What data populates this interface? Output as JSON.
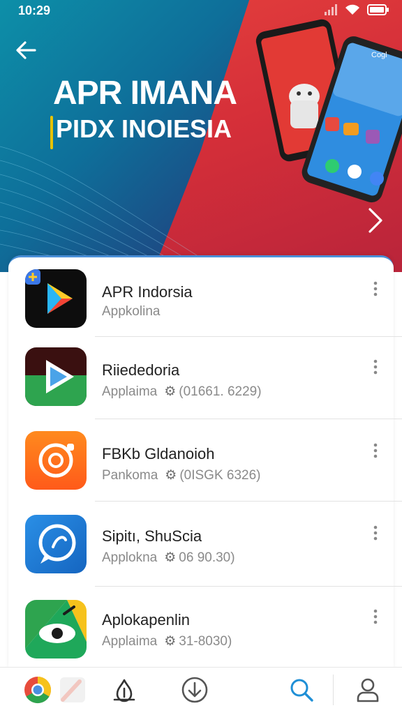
{
  "status_bar": {
    "time": "10:29"
  },
  "hero": {
    "title": "APR IMANA",
    "subtitle": "PIDX INOIESIA",
    "phone_labels": {
      "search": "Cogl"
    }
  },
  "apps": [
    {
      "name": "APR Indorsia",
      "subtitle": "Appkolina",
      "meta": "",
      "icon": "play-store-icon"
    },
    {
      "name": "Riiededoria",
      "subtitle": "Applaima",
      "meta": "(01661. 6229)",
      "icon": "play-triangle-icon"
    },
    {
      "name": "FBKb Gldanoioh",
      "subtitle": "Pankoma",
      "meta": "(0ISGK 6326)",
      "icon": "camera-ring-icon"
    },
    {
      "name": "Sipitı, ShuScia",
      "subtitle": "Applokna",
      "meta": "06 90.30)",
      "icon": "chat-bubble-icon"
    },
    {
      "name": "Aplokapenlin",
      "subtitle": "Applaima",
      "meta": "31-8030)",
      "icon": "eye-icon"
    }
  ],
  "bottom_nav": [
    {
      "id": "browser",
      "icon": "browser-icon"
    },
    {
      "id": "home",
      "icon": "home-icon"
    },
    {
      "id": "download",
      "icon": "download-icon"
    },
    {
      "id": "search",
      "icon": "search-icon"
    },
    {
      "id": "profile",
      "icon": "profile-icon"
    }
  ],
  "colors": {
    "hero_blue": "#0e6f9a",
    "hero_red": "#d52f39",
    "accent_blue": "#1f8fd6",
    "text_primary": "#222222",
    "text_secondary": "#8a8a8a"
  }
}
